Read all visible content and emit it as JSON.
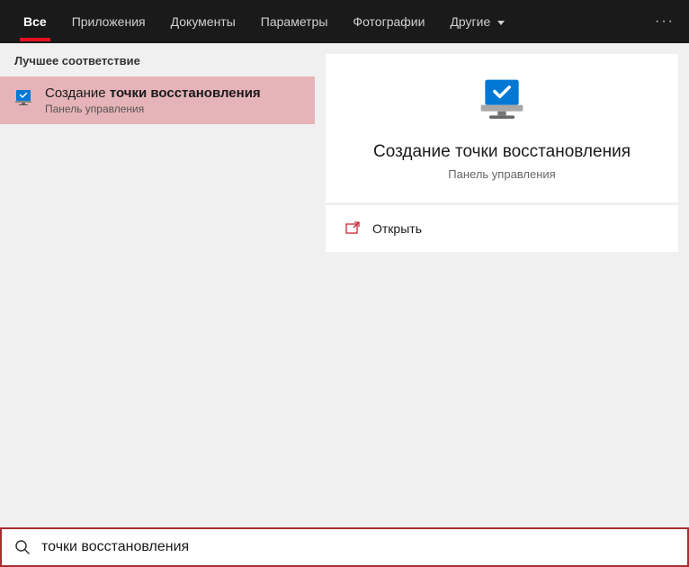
{
  "tabs": {
    "all": "Все",
    "apps": "Приложения",
    "documents": "Документы",
    "settings": "Параметры",
    "photos": "Фотографии",
    "other": "Другие"
  },
  "left": {
    "section_header": "Лучшее соответствие",
    "result_title_prefix": "Создание ",
    "result_title_bold": "точки восстановления",
    "result_subtitle": "Панель управления"
  },
  "preview": {
    "title": "Создание точки восстановления",
    "subtitle": "Панель управления",
    "open_label": "Открыть"
  },
  "search": {
    "value": "точки восстановления"
  }
}
